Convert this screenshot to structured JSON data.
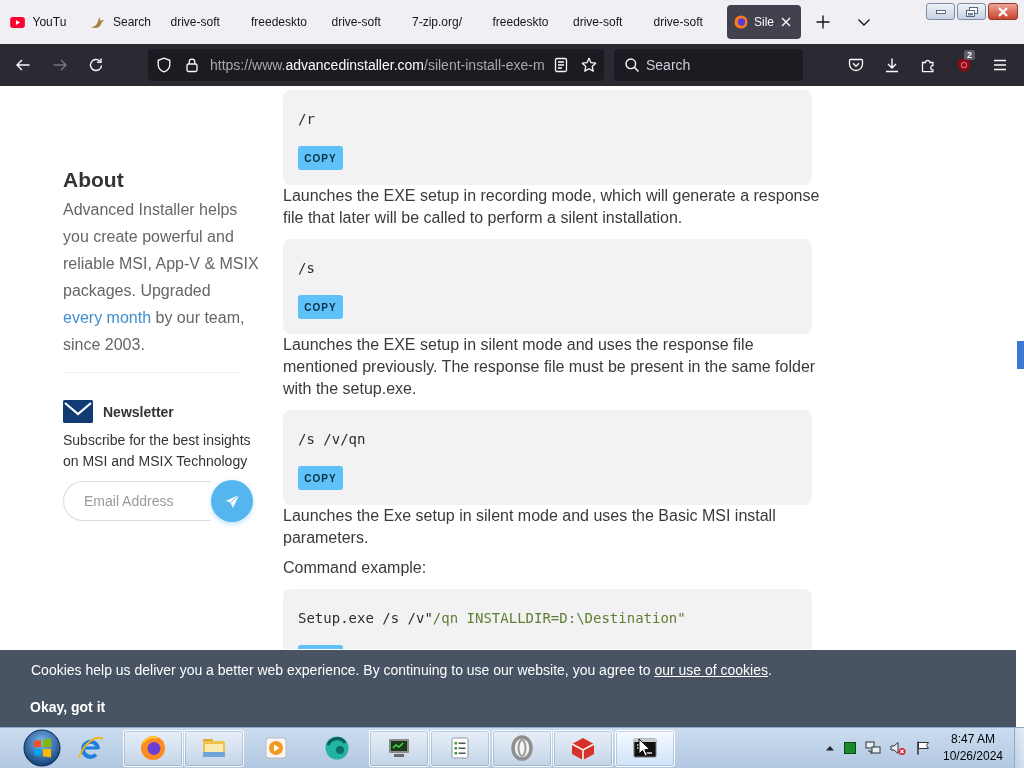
{
  "browser_tabs": [
    {
      "title": "YouTu",
      "kind": "video",
      "selected": false
    },
    {
      "title": "Search",
      "kind": "bird",
      "selected": false
    },
    {
      "title": "drive-soft",
      "kind": "plain",
      "selected": false
    },
    {
      "title": "freedeskto",
      "kind": "plain",
      "selected": false
    },
    {
      "title": "drive-soft",
      "kind": "plain",
      "selected": false
    },
    {
      "title": "7-zip.org/",
      "kind": "plain",
      "selected": false
    },
    {
      "title": "freedeskto",
      "kind": "plain",
      "selected": false
    },
    {
      "title": "drive-soft",
      "kind": "plain",
      "selected": false
    },
    {
      "title": "drive-soft",
      "kind": "plain",
      "selected": false
    },
    {
      "title": "Sile",
      "kind": "logo",
      "selected": true
    }
  ],
  "toolbar": {
    "back": {
      "disabled": false
    },
    "forward": {
      "disabled": true
    },
    "address": {
      "scheme": "https://www.",
      "domain": "advancedinstaller.com",
      "path": "/silent-install-exe-m"
    },
    "search": {
      "placeholder": "Search"
    },
    "extension_badge": "2"
  },
  "sidebar": {
    "about": {
      "title": "About",
      "text_before": "Advanced Installer helps you create powerful and reliable MSI, App-V & MSIX packages. Upgraded ",
      "link": "every month",
      "text_after": " by our team, since 2003."
    },
    "newsletter": {
      "title": "Newsletter",
      "text": "Subscribe for the best insights on MSI and MSIX Technology",
      "email_placeholder": "Email Address"
    }
  },
  "article": [
    {
      "kind": "code",
      "tokens": [
        {
          "text": "/r",
          "kind": "plain"
        }
      ],
      "copy": {
        "label": "COPY",
        "cut": false
      }
    },
    {
      "kind": "paragraph",
      "text": "Launches the EXE setup in recording mode, which will generate a response file that later will be called to perform a silent installation."
    },
    {
      "kind": "code",
      "tokens": [
        {
          "text": "/s",
          "kind": "plain"
        }
      ],
      "copy": {
        "label": "COPY",
        "cut": false
      }
    },
    {
      "kind": "paragraph",
      "text": "Launches the EXE setup in silent mode and uses the response file mentioned previously. The response file must be present in the same folder with the setup.exe."
    },
    {
      "kind": "code",
      "tokens": [
        {
          "text": "/s /v/qn",
          "kind": "plain"
        }
      ],
      "copy": {
        "label": "COPY",
        "cut": false
      }
    },
    {
      "kind": "paragraph",
      "text": "Launches the Exe setup in silent mode and uses the Basic MSI install parameters."
    },
    {
      "kind": "paragraph",
      "text": "Command example:"
    },
    {
      "kind": "code",
      "tokens": [
        {
          "text": "Setup.exe /s /v\"",
          "kind": "plain"
        },
        {
          "text": "/qn INSTALLDIR=D:\\Destination\"",
          "kind": "string"
        }
      ],
      "copy": {
        "cut": true
      }
    }
  ],
  "cookie_banner": {
    "text": "Cookies help us deliver you a better web experience. By continuing to use our website, you agree to ",
    "link": "our use of cookies",
    "text_end": ".",
    "button": "Okay, got it"
  },
  "taskbar": {
    "apps": [
      {
        "kind": "web",
        "running": false,
        "selected": false
      },
      {
        "kind": "browser",
        "running": true,
        "selected": false
      },
      {
        "kind": "folder",
        "running": true,
        "selected": false
      },
      {
        "kind": "media",
        "running": false,
        "selected": false
      },
      {
        "kind": "sphere",
        "running": false,
        "selected": false
      },
      {
        "kind": "monitor",
        "running": true,
        "selected": false
      },
      {
        "kind": "list",
        "running": true,
        "selected": false
      },
      {
        "kind": "ring",
        "running": true,
        "selected": false
      },
      {
        "kind": "cube",
        "running": true,
        "selected": false
      },
      {
        "kind": "terminal",
        "running": true,
        "selected": true
      }
    ],
    "clock": {
      "time": "8:47 AM",
      "date": "10/26/2024"
    }
  }
}
